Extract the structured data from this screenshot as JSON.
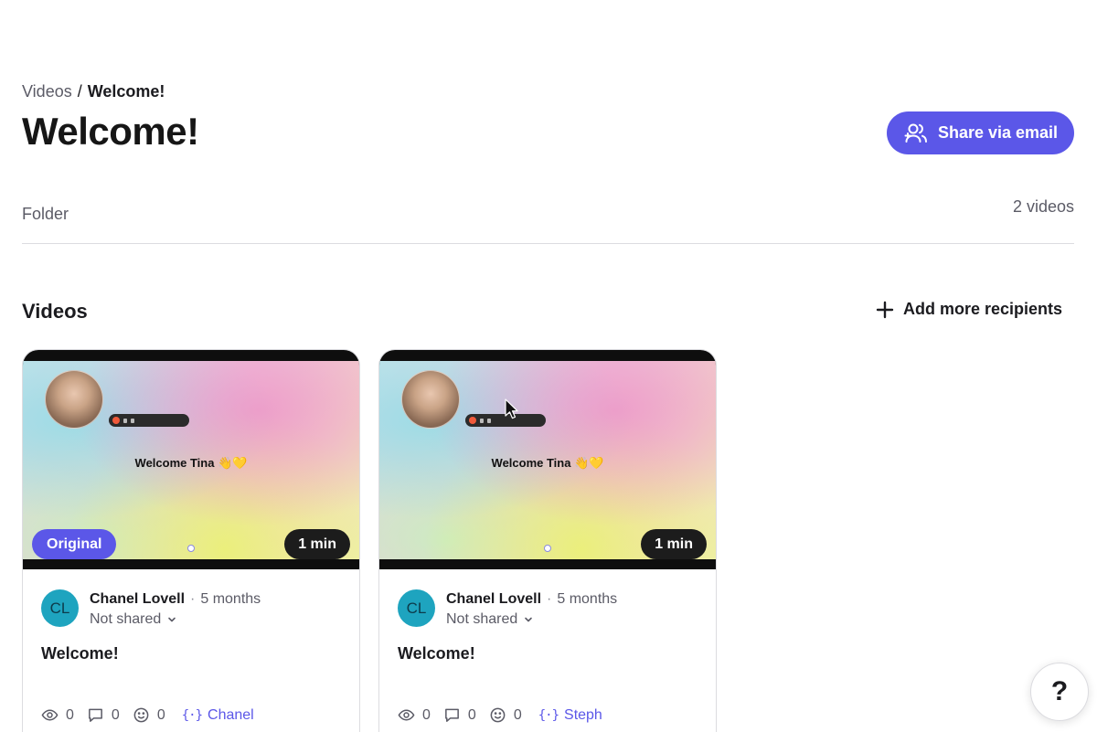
{
  "breadcrumb": {
    "parent": "Videos",
    "separator": "/",
    "current": "Welcome!"
  },
  "page": {
    "title": "Welcome!",
    "type_label": "Folder",
    "video_count": "2 videos"
  },
  "header": {
    "share_label": "Share via email"
  },
  "videos_section": {
    "title": "Videos",
    "add_label": "Add more recipients"
  },
  "colors": {
    "accent": "#5b57e8",
    "avatar": "#1ea4bf"
  },
  "cards": [
    {
      "badge": "Original",
      "duration": "1 min",
      "caption": "Welcome Tina 👋💛",
      "avatar_initials": "CL",
      "author": "Chanel Lovell",
      "dot": "·",
      "time": "5 months",
      "share_state": "Not shared",
      "title": "Welcome!",
      "views": "0",
      "comments": "0",
      "reactions": "0",
      "variable_brace": "{·}",
      "variable": "Chanel"
    },
    {
      "badge": "",
      "duration": "1 min",
      "caption": "Welcome Tina 👋💛",
      "avatar_initials": "CL",
      "author": "Chanel Lovell",
      "dot": "·",
      "time": "5 months",
      "share_state": "Not shared",
      "title": "Welcome!",
      "views": "0",
      "comments": "0",
      "reactions": "0",
      "variable_brace": "{·}",
      "variable": "Steph"
    }
  ],
  "help": {
    "label": "?"
  }
}
